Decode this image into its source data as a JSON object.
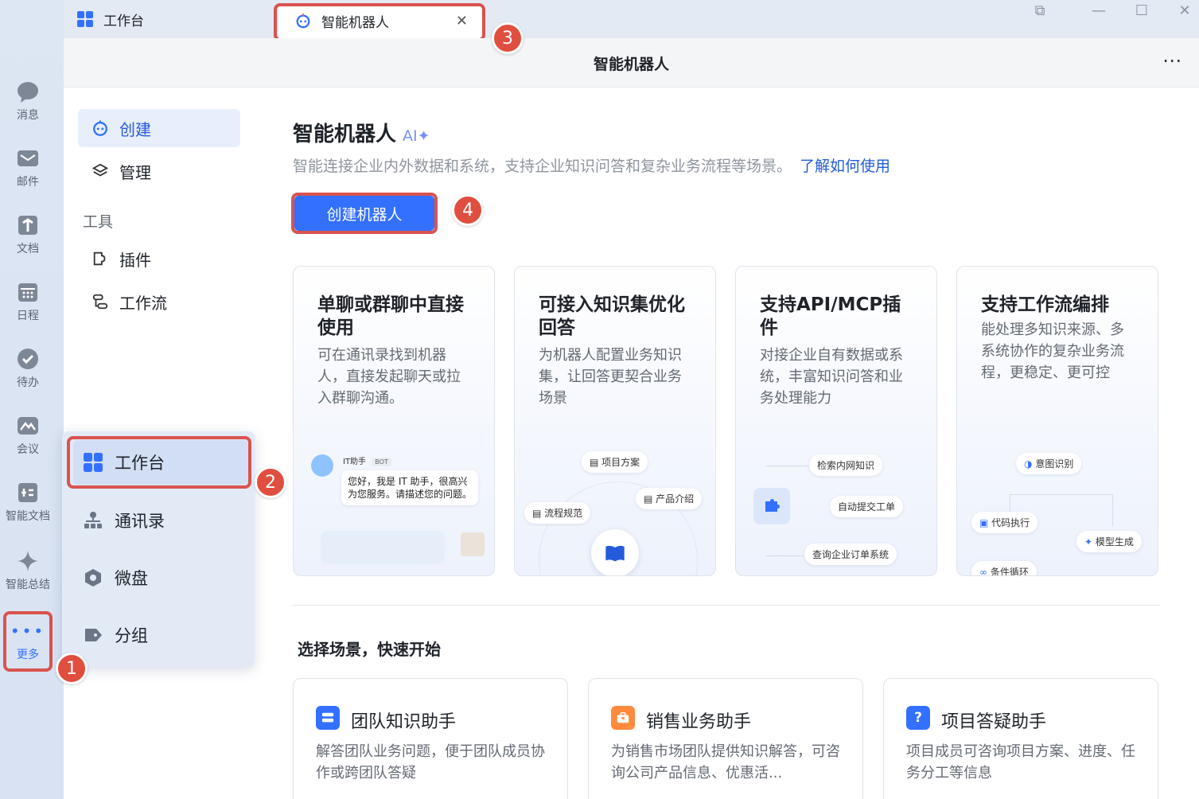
{
  "rail": {
    "items": [
      {
        "label": "消息",
        "icon": "message-icon"
      },
      {
        "label": "邮件",
        "icon": "mail-icon"
      },
      {
        "label": "文档",
        "icon": "docs-icon"
      },
      {
        "label": "日程",
        "icon": "calendar-icon"
      },
      {
        "label": "待办",
        "icon": "todo-icon"
      },
      {
        "label": "会议",
        "icon": "meeting-icon"
      },
      {
        "label": "智能文档",
        "icon": "smart-doc-icon"
      },
      {
        "label": "智能总结",
        "icon": "sparkle-icon"
      },
      {
        "label": "更多",
        "icon": "more-dots-icon"
      }
    ]
  },
  "tabs": [
    {
      "label": "工作台",
      "icon": "grid-icon"
    },
    {
      "label": "智能机器人",
      "icon": "robot-icon"
    }
  ],
  "header": {
    "title": "智能机器人",
    "more": "⋯"
  },
  "sidenav": {
    "create": "创建",
    "manage": "管理",
    "tools_section": "工具",
    "plugins": "插件",
    "workflow": "工作流"
  },
  "main": {
    "title": "智能机器人",
    "ai_tag": "AI✦",
    "description": "智能连接企业内外数据和系统，支持企业知识问答和复杂业务流程等场景。",
    "learn_link": "了解如何使用",
    "create_button": "创建机器人"
  },
  "features": [
    {
      "title": "单聊或群聊中直接使用",
      "desc": "可在通讯录找到机器人，直接发起聊天或拉入群聊沟通。"
    },
    {
      "title": "可接入知识集优化回答",
      "desc": "为机器人配置业务知识集，让回答更契合业务场景"
    },
    {
      "title": "支持API/MCP插件",
      "desc": "对接企业自有数据或系统，丰富知识问答和业务处理能力"
    },
    {
      "title": "支持工作流编排",
      "desc": "能处理多知识来源、多系统协作的复杂业务流程，更稳定、更可控"
    }
  ],
  "card1_preview": {
    "bot_name": "IT助手",
    "bot_tag": "BOT",
    "bubble": "您好，我是 IT 助手，很高兴为您服务。请描述您的问题。"
  },
  "card2_preview": {
    "pill1": "项目方案",
    "pill2": "产品介绍",
    "pill3": "流程规范"
  },
  "card3_preview": {
    "pill1": "检索内网知识",
    "pill2": "自动提交工单",
    "pill3": "查询企业订单系统"
  },
  "card4_preview": {
    "pill1": "意图识别",
    "pill2": "代码执行",
    "pill3": "模型生成",
    "pill4": "条件循环"
  },
  "scenarios": {
    "title": "选择场景，快速开始",
    "items": [
      {
        "title": "团队知识助手",
        "desc": "解答团队业务问题，便于团队成员协作或跨团队答疑",
        "color": "#3370ff"
      },
      {
        "title": "销售业务助手",
        "desc": "为销售市场团队提供知识解答，可咨询公司产品信息、优惠活...",
        "color": "#ff8a3d"
      },
      {
        "title": "项目答疑助手",
        "desc": "项目成员可咨询项目方案、进度、任务分工等信息",
        "color": "#3370ff"
      }
    ]
  },
  "popup": {
    "items": [
      {
        "label": "工作台",
        "icon": "grid-icon"
      },
      {
        "label": "通讯录",
        "icon": "contacts-icon"
      },
      {
        "label": "微盘",
        "icon": "drive-icon"
      },
      {
        "label": "分组",
        "icon": "tag-icon"
      }
    ]
  },
  "steps": [
    "1",
    "2",
    "3",
    "4"
  ],
  "colors": {
    "accent": "#3370ff",
    "highlight": "#d9534f",
    "step_badge": "#e04e3f"
  }
}
